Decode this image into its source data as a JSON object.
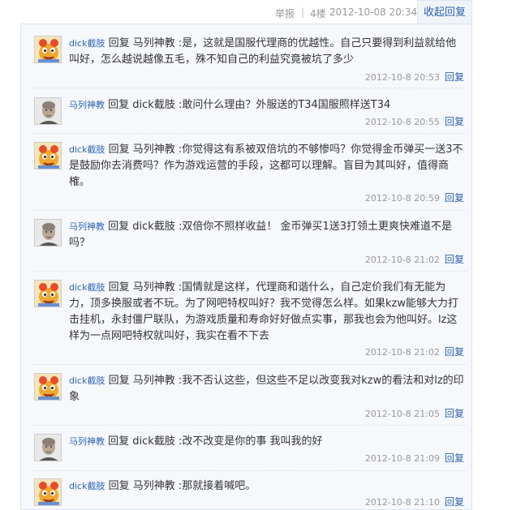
{
  "topbar": {
    "report": "举报",
    "separator": "|",
    "floor": "4楼",
    "datetime": "2012-10-08 20:34",
    "collapse": "收起回复"
  },
  "replies": [
    {
      "user": "dick截肢",
      "avatar": "cartoon-avatar",
      "prefix": "回复 马列神教 :",
      "text": "是，这就是国服代理商的优越性。自己只要得到利益就给他叫好，怎么越说越像五毛，殊不知自己的利益究竟被坑了多少",
      "time": "2012-10-8 20:53",
      "reply_label": "回复"
    },
    {
      "user": "马列神教",
      "avatar": "portrait-avatar",
      "prefix": "回复 dick截肢 :",
      "text": "敢问什么理由？外服送的T34国服照样送T34",
      "time": "2012-10-8 20:55",
      "reply_label": "回复"
    },
    {
      "user": "dick截肢",
      "avatar": "cartoon-avatar",
      "prefix": "回复 马列神教 :",
      "text": "你觉得这有系被双倍坑的不够惨吗？你觉得金币弹买一送3不是鼓励你去消费吗？作为游戏运营的手段，这都可以理解。盲目为其叫好，值得商榷。",
      "time": "2012-10-8 20:59",
      "reply_label": "回复"
    },
    {
      "user": "马列神教",
      "avatar": "portrait-avatar",
      "prefix": "回复 dick截肢 :",
      "text": "双倍你不照样收益！ 金币弹买1送3打领土更爽快难道不是吗？",
      "time": "2012-10-8 21:02",
      "reply_label": "回复"
    },
    {
      "user": "dick截肢",
      "avatar": "cartoon-avatar",
      "prefix": "回复 马列神教 :",
      "text": "国情就是这样，代理商和谐什么，自己定价我们有无能为力，顶多换服或者不玩。为了网吧特权叫好？我不觉得怎么样。如果kzw能够大力打击挂机，永封僵尸联队，为游戏质量和寿命好好做点实事，那我也会为他叫好。lz这样为一点网吧特权就叫好，我实在看不下去",
      "time": "2012-10-8 21:02",
      "reply_label": "回复"
    },
    {
      "user": "dick截肢",
      "avatar": "cartoon-avatar",
      "prefix": "回复 马列神教 :",
      "text": "我不否认这些，但这些不足以改变我对kzw的看法和对lz的印象",
      "time": "2012-10-8 21:05",
      "reply_label": "回复"
    },
    {
      "user": "马列神教",
      "avatar": "portrait-avatar",
      "prefix": "回复 dick截肢 :",
      "text": "改不改变是你的事 我叫我的好",
      "time": "2012-10-8 21:09",
      "reply_label": "回复"
    },
    {
      "user": "dick截肢",
      "avatar": "cartoon-avatar",
      "prefix": "回复 马列神教 :",
      "text": "那就接着喊吧。",
      "time": "2012-10-8 21:10",
      "reply_label": "回复"
    }
  ],
  "colors": {
    "link": "#2d64b3",
    "panel_bg": "#f6f8fc",
    "meta_text": "#999999",
    "body_text": "#333333"
  }
}
